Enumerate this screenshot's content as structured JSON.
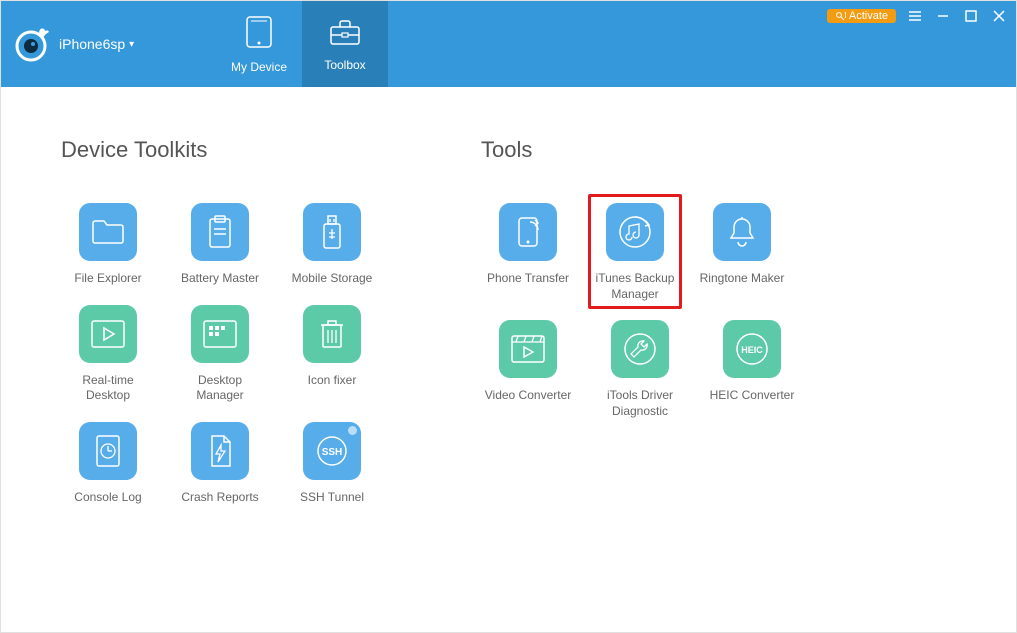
{
  "header": {
    "device_name": "iPhone6sp",
    "tabs": {
      "my_device": "My Device",
      "toolbox": "Toolbox"
    },
    "activate_label": "Activate"
  },
  "sections": {
    "device_toolkits_title": "Device Toolkits",
    "tools_title": "Tools"
  },
  "device_toolkits": {
    "file_explorer": "File Explorer",
    "battery_master": "Battery Master",
    "mobile_storage": "Mobile Storage",
    "realtime_desktop": "Real-time Desktop",
    "desktop_manager": "Desktop Manager",
    "icon_fixer": "Icon fixer",
    "console_log": "Console Log",
    "crash_reports": "Crash Reports",
    "ssh_tunnel": "SSH Tunnel",
    "ssh_text": "SSH"
  },
  "tools": {
    "phone_transfer": "Phone Transfer",
    "itunes_backup": "iTunes Backup Manager",
    "ringtone_maker": "Ringtone Maker",
    "video_converter": "Video Converter",
    "driver_diagnostic": "iTools Driver Diagnostic",
    "heic_converter": "HEIC Converter",
    "heic_text": "HEIC"
  },
  "colors": {
    "header_bg": "#3498db",
    "header_active": "#2980b9",
    "tile_blue": "#56adea",
    "tile_green": "#5cc9a7",
    "activate_bg": "#f39c12",
    "highlight": "#e21c1c"
  }
}
